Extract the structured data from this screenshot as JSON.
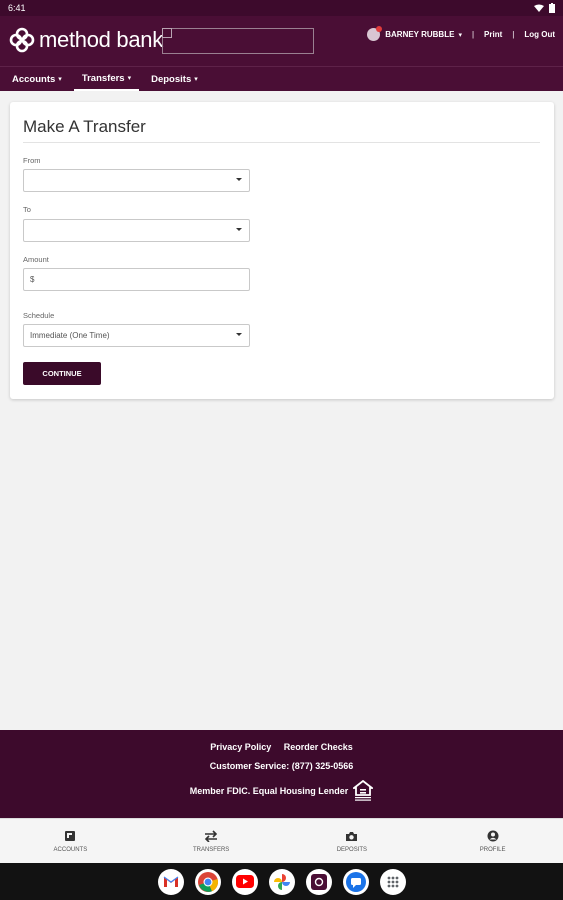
{
  "status_bar": {
    "time": "6:41"
  },
  "header": {
    "brand": "method bank",
    "user_name": "BARNEY RUBBLE",
    "print_label": "Print",
    "separator": "|",
    "logout_label": "Log Out"
  },
  "nav": {
    "items": [
      {
        "label": "Accounts"
      },
      {
        "label": "Transfers"
      },
      {
        "label": "Deposits"
      }
    ]
  },
  "form": {
    "title": "Make A Transfer",
    "from_label": "From",
    "from_value": "",
    "to_label": "To",
    "to_value": "",
    "amount_label": "Amount",
    "amount_value": "$",
    "schedule_label": "Schedule",
    "schedule_value": "Immediate (One Time)",
    "continue_label": "CONTINUE"
  },
  "footer": {
    "privacy_label": "Privacy Policy",
    "reorder_label": "Reorder Checks",
    "customer_service": "Customer Service: (877) 325-0566",
    "member_text": "Member FDIC. Equal Housing Lender"
  },
  "tabbar": {
    "items": [
      {
        "label": "ACCOUNTS",
        "icon": "accounts-icon"
      },
      {
        "label": "TRANSFERS",
        "icon": "transfer-arrows-icon"
      },
      {
        "label": "DEPOSITS",
        "icon": "camera-icon"
      },
      {
        "label": "PROFILE",
        "icon": "profile-icon"
      }
    ]
  },
  "dock": {
    "apps": [
      "gmail-icon",
      "chrome-icon",
      "youtube-icon",
      "photos-icon",
      "bank-app-icon",
      "messages-icon",
      "app-drawer-icon"
    ]
  },
  "colors": {
    "brand_dark": "#4a0e35",
    "footer_bg": "#3d0a2c",
    "button_bg": "#3a0a29"
  }
}
